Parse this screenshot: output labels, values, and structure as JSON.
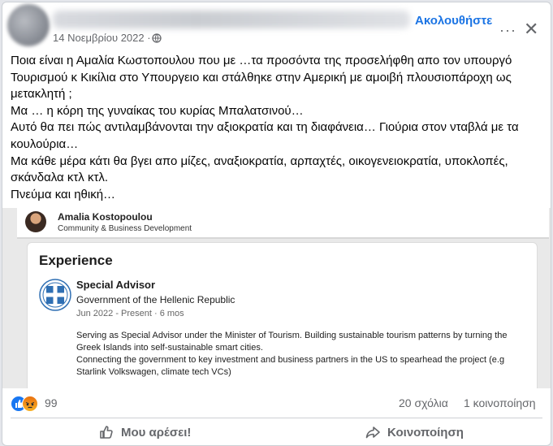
{
  "post": {
    "date": "14 Νοεμβρίου 2022 ·",
    "follow_label": "Ακολουθήστε",
    "more_label": "···",
    "close_label": "✕",
    "icons": {
      "privacy": "globe-icon",
      "more": "more-icon",
      "close": "close-icon"
    },
    "lines": [
      "Ποια είναι η Αμαλία Κωστοπουλου που με …τα προσόντα της προσελήφθη απο τον υπουργό",
      "Τουρισμού κ Κικίλια στο Υπουργειο και στάλθηκε στην Αμερική με αμοιβή πλουσιοπάροχη ως",
      "μετακλητή ;",
      "Μα … η κόρη της γυναίκας του κυρίας Μπαλατσινού…",
      "Αυτό θα πει πώς αντιλαμβάνονται την αξιοκρατία και τη διαφάνεια… Γιούρια στον νταβλά με τα",
      "κουλούρια…",
      "Μα κάθε μέρα κάτι θα βγει απο μίζες, αναξιοκρατία, αρπαχτές, οικογενειοκρατία, υποκλοπές,",
      "σκάνδαλα κτλ κτλ.",
      "Πνεύμα και ηθική…"
    ]
  },
  "screenshot": {
    "name": "Amalia Kostopoulou",
    "role": "Community & Business Development",
    "section_title": "Experience",
    "job_title": "Special Advisor",
    "organization": "Government of the Hellenic Republic",
    "dates": "Jun 2022 - Present · 6 mos",
    "description": [
      "Serving as Special Advisor under the Minister of Tourism. Building sustainable tourism patterns by turning the",
      "Greek Islands into self-sustainable smart cities.",
      "Connecting the government to key investment and business partners in the US to spearhead the project (e.g",
      "Starlink Volkswagen, climate tech VCs)"
    ]
  },
  "footer": {
    "reaction_count": "99",
    "comments": "20 σχόλια",
    "shares": "1 κοινοποίηση",
    "like_label": "Μου αρέσει!",
    "share_label": "Κοινοποίηση",
    "reaction_icons": [
      "like-reaction-icon",
      "angry-reaction-icon"
    ]
  },
  "colors": {
    "accent": "#1b74e4",
    "like": "#1877f2",
    "muted_text": "#65676b"
  }
}
